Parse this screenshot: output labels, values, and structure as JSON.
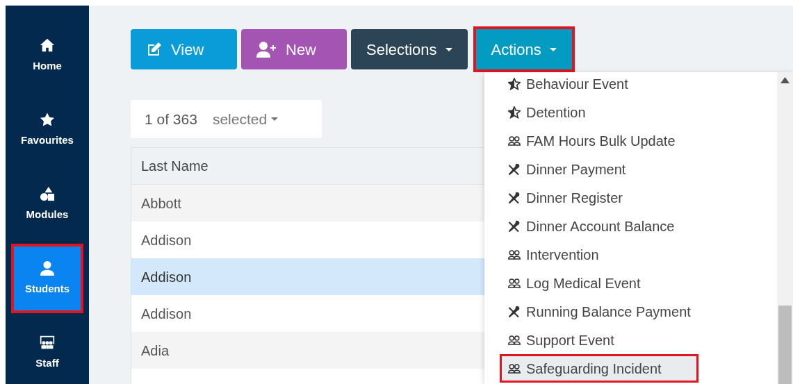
{
  "sidebar": {
    "items": [
      {
        "label": "Home",
        "kind": "home",
        "selected": false,
        "highlighted": false
      },
      {
        "label": "Favourites",
        "kind": "star",
        "selected": false,
        "highlighted": false
      },
      {
        "label": "Modules",
        "kind": "shapes",
        "selected": false,
        "highlighted": false
      },
      {
        "label": "Students",
        "kind": "person",
        "selected": true,
        "highlighted": true
      },
      {
        "label": "Staff",
        "kind": "staff",
        "selected": false,
        "highlighted": false
      }
    ]
  },
  "toolbar": {
    "buttons": [
      {
        "label": "View",
        "kind": "view",
        "caret": false,
        "highlighted": false
      },
      {
        "label": "New",
        "kind": "new",
        "caret": false,
        "highlighted": false
      },
      {
        "label": "Selections",
        "kind": "selections",
        "caret": true,
        "highlighted": false
      },
      {
        "label": "Actions",
        "kind": "actions",
        "caret": true,
        "highlighted": true
      }
    ]
  },
  "selection": {
    "count": "1 of 363",
    "label": "selected"
  },
  "table": {
    "columns": [
      "Last Name"
    ],
    "rows": [
      {
        "cells": [
          "Abbott"
        ],
        "selected": false
      },
      {
        "cells": [
          "Addison"
        ],
        "selected": false
      },
      {
        "cells": [
          "Addison"
        ],
        "selected": true
      },
      {
        "cells": [
          "Addison"
        ],
        "selected": false
      },
      {
        "cells": [
          "Adia"
        ],
        "selected": false
      },
      {
        "cells": [],
        "selected": false
      }
    ]
  },
  "actions_menu": {
    "items": [
      {
        "label": "Behaviour Event",
        "kind": "star",
        "hovered": false,
        "highlighted": false
      },
      {
        "label": "Detention",
        "kind": "star",
        "hovered": false,
        "highlighted": false
      },
      {
        "label": "FAM Hours Bulk Update",
        "kind": "people",
        "hovered": false,
        "highlighted": false
      },
      {
        "label": "Dinner Payment",
        "kind": "cutlery",
        "hovered": false,
        "highlighted": false
      },
      {
        "label": "Dinner Register",
        "kind": "cutlery",
        "hovered": false,
        "highlighted": false
      },
      {
        "label": "Dinner Account Balance",
        "kind": "cutlery",
        "hovered": false,
        "highlighted": false
      },
      {
        "label": "Intervention",
        "kind": "people",
        "hovered": false,
        "highlighted": false
      },
      {
        "label": "Log Medical Event",
        "kind": "people",
        "hovered": false,
        "highlighted": false
      },
      {
        "label": "Running Balance Payment",
        "kind": "cutlery",
        "hovered": false,
        "highlighted": false
      },
      {
        "label": "Support Event",
        "kind": "people",
        "hovered": false,
        "highlighted": false
      },
      {
        "label": "Safeguarding Incident",
        "kind": "people",
        "hovered": true,
        "highlighted": true
      }
    ]
  }
}
